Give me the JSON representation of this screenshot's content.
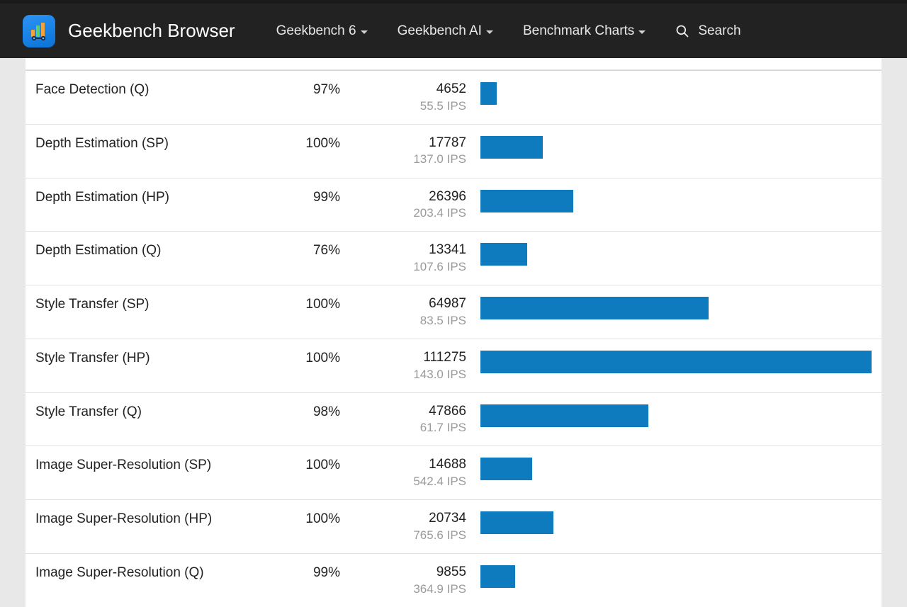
{
  "brand": "Geekbench Browser",
  "nav": {
    "gb6": "Geekbench 6",
    "gbai": "Geekbench AI",
    "charts": "Benchmark Charts",
    "search": "Search"
  },
  "bar_color": "#0f7bbf",
  "max_score": 111275,
  "rows": [
    {
      "name": "Face Detection (Q)",
      "pct": "97%",
      "score": "4652",
      "ips": "55.5 IPS",
      "val": 4652
    },
    {
      "name": "Depth Estimation (SP)",
      "pct": "100%",
      "score": "17787",
      "ips": "137.0 IPS",
      "val": 17787
    },
    {
      "name": "Depth Estimation (HP)",
      "pct": "99%",
      "score": "26396",
      "ips": "203.4 IPS",
      "val": 26396
    },
    {
      "name": "Depth Estimation (Q)",
      "pct": "76%",
      "score": "13341",
      "ips": "107.6 IPS",
      "val": 13341
    },
    {
      "name": "Style Transfer (SP)",
      "pct": "100%",
      "score": "64987",
      "ips": "83.5 IPS",
      "val": 64987
    },
    {
      "name": "Style Transfer (HP)",
      "pct": "100%",
      "score": "111275",
      "ips": "143.0 IPS",
      "val": 111275
    },
    {
      "name": "Style Transfer (Q)",
      "pct": "98%",
      "score": "47866",
      "ips": "61.7 IPS",
      "val": 47866
    },
    {
      "name": "Image Super-Resolution (SP)",
      "pct": "100%",
      "score": "14688",
      "ips": "542.4 IPS",
      "val": 14688
    },
    {
      "name": "Image Super-Resolution (HP)",
      "pct": "100%",
      "score": "20734",
      "ips": "765.6 IPS",
      "val": 20734
    },
    {
      "name": "Image Super-Resolution (Q)",
      "pct": "99%",
      "score": "9855",
      "ips": "364.9 IPS",
      "val": 9855
    }
  ],
  "chart_data": {
    "type": "bar",
    "title": "",
    "xlabel": "",
    "ylabel": "",
    "categories": [
      "Face Detection (Q)",
      "Depth Estimation (SP)",
      "Depth Estimation (HP)",
      "Depth Estimation (Q)",
      "Style Transfer (SP)",
      "Style Transfer (HP)",
      "Style Transfer (Q)",
      "Image Super-Resolution (SP)",
      "Image Super-Resolution (HP)",
      "Image Super-Resolution (Q)"
    ],
    "values": [
      4652,
      17787,
      26396,
      13341,
      64987,
      111275,
      47866,
      14688,
      20734,
      9855
    ],
    "ylim": [
      0,
      111275
    ]
  }
}
